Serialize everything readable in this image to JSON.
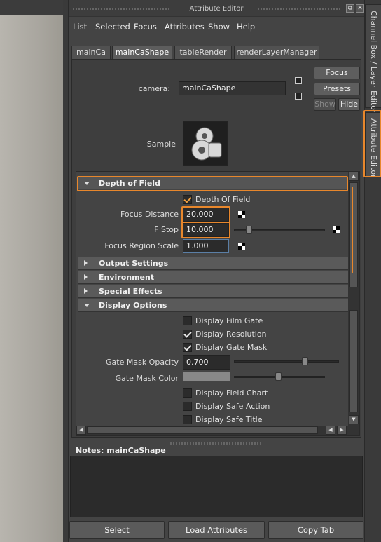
{
  "window": {
    "title": "Attribute Editor",
    "float_btn": "⧉",
    "close_btn": "✕"
  },
  "menu": [
    "List",
    "Selected",
    "Focus",
    "Attributes",
    "Show",
    "Help"
  ],
  "tabs": [
    {
      "label": "mainCa",
      "active": false
    },
    {
      "label": "mainCaShape",
      "active": true
    },
    {
      "label": "tableRender",
      "active": false
    },
    {
      "label": "renderLayerManager",
      "active": false
    }
  ],
  "camera": {
    "label": "camera:",
    "value": "mainCaShape"
  },
  "buttons": {
    "focus": "Focus",
    "presets": "Presets",
    "show": "Show",
    "hide": "Hide"
  },
  "sample": {
    "label": "Sample"
  },
  "depth_of_field": {
    "title": "Depth of Field",
    "checkbox_label": "Depth Of Field",
    "checked": true,
    "focus_distance": {
      "label": "Focus Distance",
      "value": "20.000"
    },
    "f_stop": {
      "label": "F Stop",
      "value": "10.000"
    },
    "focus_region_scale": {
      "label": "Focus Region Scale",
      "value": "1.000"
    }
  },
  "sections": {
    "output": "Output Settings",
    "environment": "Environment",
    "special": "Special Effects",
    "display": "Display Options"
  },
  "display_options": {
    "film_gate": {
      "label": "Display Film Gate",
      "checked": false
    },
    "resolution": {
      "label": "Display Resolution",
      "checked": true
    },
    "gate_mask": {
      "label": "Display Gate Mask",
      "checked": true
    },
    "gate_mask_opacity": {
      "label": "Gate Mask Opacity",
      "value": "0.700"
    },
    "gate_mask_color": {
      "label": "Gate Mask Color"
    },
    "field_chart": {
      "label": "Display Field Chart",
      "checked": false
    },
    "safe_action": {
      "label": "Display Safe Action",
      "checked": false
    },
    "safe_title": {
      "label": "Display Safe Title",
      "checked": false
    }
  },
  "notes": {
    "label": "Notes:  mainCaShape"
  },
  "bottom": {
    "select": "Select",
    "load": "Load Attributes",
    "copy": "Copy Tab"
  },
  "side_tabs": {
    "channel_box": "Channel Box / Layer Editor",
    "attribute_editor": "Attribute Editor"
  },
  "colors": {
    "highlight": "#e8872c",
    "panel": "#444444",
    "field": "#2b2b2b"
  }
}
